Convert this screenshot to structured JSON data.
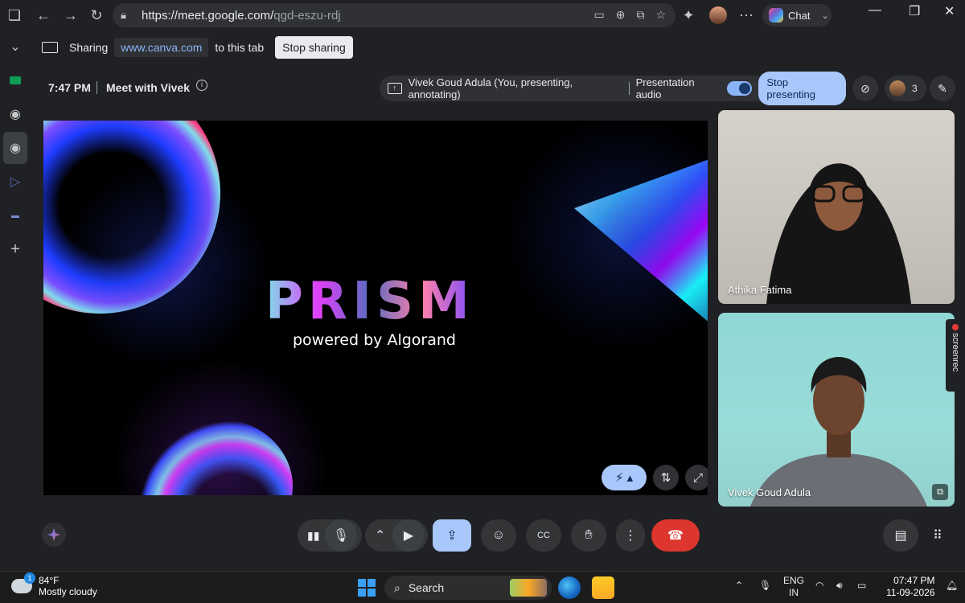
{
  "browser": {
    "url_main": "https://meet.google.com/",
    "url_path": "qgd-eszu-rdj",
    "chat_label": "Chat"
  },
  "sharing": {
    "label": "Sharing",
    "domain": "www.canva.com",
    "suffix": "to this tab",
    "stop_label": "Stop sharing"
  },
  "meet": {
    "time": "7:47 PM",
    "title": "Meet with Vivek",
    "presenting_text": "Vivek Goud Adula (You, presenting, annotating)",
    "audio_label": "Presentation audio",
    "stop_presenting": "Stop presenting",
    "participant_count": "3"
  },
  "slide": {
    "title": "PRISM",
    "subtitle": "powered by Algorand"
  },
  "tiles": [
    {
      "name": "Athika Fatima"
    },
    {
      "name": "Vivek Goud Adula"
    }
  ],
  "screenrec": "screenrec",
  "taskbar": {
    "temp": "84°F",
    "weather": "Mostly cloudy",
    "weather_badge": "1",
    "search_label": "Search",
    "lang1": "ENG",
    "lang2": "IN",
    "time": "07:47 PM",
    "date": "11-09-2026"
  }
}
